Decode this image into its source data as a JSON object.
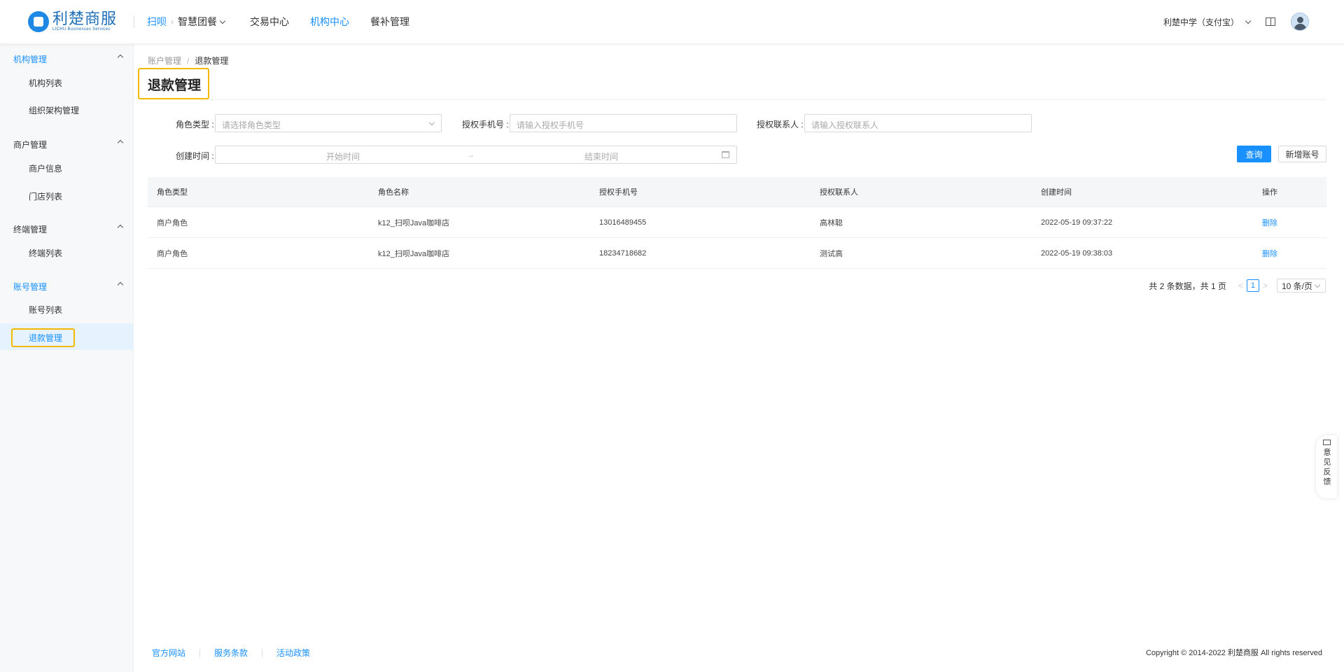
{
  "header": {
    "brand_cn": "利楚商服",
    "brand_en": "LICHU Businesses Services",
    "nav_scan": "扫呗",
    "nav_sep": "›",
    "nav_items": [
      "智慧团餐",
      "交易中心",
      "机构中心",
      "餐补管理"
    ],
    "active_nav": "机构中心",
    "school": "利楚中学（支付宝）"
  },
  "sidebar": {
    "groups": [
      {
        "title": "机构管理",
        "items": [
          "机构列表",
          "组织架构管理"
        ]
      },
      {
        "title": "商户管理",
        "items": [
          "商户信息",
          "门店列表"
        ]
      },
      {
        "title": "终端管理",
        "items": [
          "终端列表"
        ]
      },
      {
        "title": "账号管理",
        "items": [
          "账号列表",
          "退款管理"
        ]
      }
    ],
    "active_item": "退款管理"
  },
  "breadcrumb": {
    "parent": "账户管理",
    "separator": "/",
    "current": "退款管理"
  },
  "page_title": "退款管理",
  "filters": {
    "role_type_label": "角色类型 :",
    "role_type_placeholder": "请选择角色类型",
    "phone_label": "授权手机号 :",
    "phone_placeholder": "请输入授权手机号",
    "contact_label": "授权联系人 :",
    "contact_placeholder": "请输入授权联系人",
    "created_label": "创建时间 :",
    "start_placeholder": "开始时间",
    "range_arrow": "→",
    "end_placeholder": "结束时间"
  },
  "buttons": {
    "query": "查询",
    "add_account": "新增账号"
  },
  "table": {
    "columns": [
      "角色类型",
      "角色名称",
      "授权手机号",
      "授权联系人",
      "创建时间",
      "操作"
    ],
    "rows": [
      [
        "商户角色",
        "k12_扫呗Java咖啡店",
        "13016489455",
        "高林聪",
        "2022-05-19 09:37:22",
        "删除"
      ],
      [
        "商户角色",
        "k12_扫呗Java咖啡店",
        "18234718682",
        "测试高",
        "2022-05-19 09:38:03",
        "删除"
      ]
    ]
  },
  "pagination": {
    "total_text": "共 2 条数据，共 1 页",
    "prev": "<",
    "current_page": "1",
    "next": ">",
    "page_size": "10 条/页"
  },
  "footer": {
    "links": [
      "官方网站",
      "服务条款",
      "活动政策"
    ],
    "copyright": "Copyright © 2014-2022 利楚商服 All rights reserved"
  },
  "feedback": {
    "label": "意见反馈"
  },
  "colors": {
    "primary": "#1890ff",
    "highlight_box": "#f5b800",
    "sidebar_bg": "#f7f8fa",
    "active_bg": "#e6f3fe"
  }
}
